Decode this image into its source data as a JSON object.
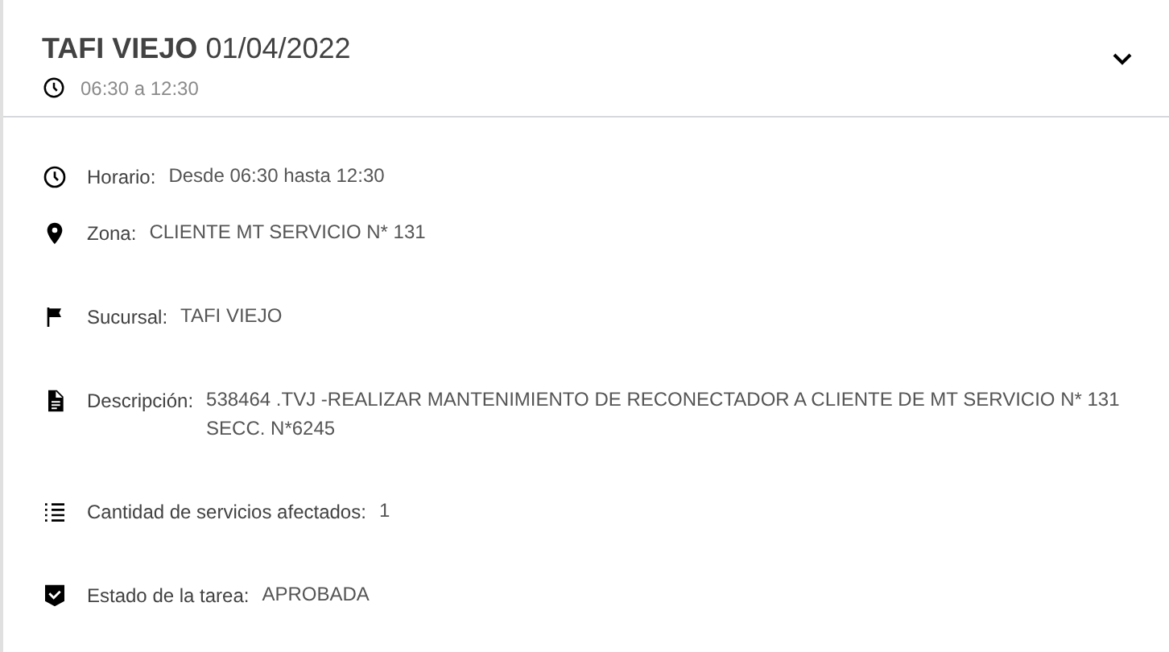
{
  "header": {
    "title": "TAFI VIEJO",
    "date": "01/04/2022",
    "time_range": "06:30 a 12:30",
    "expanded": true
  },
  "fields": [
    {
      "kind": "clock",
      "label": "Horario:",
      "value": "Desde 06:30 hasta 12:30"
    },
    {
      "kind": "pin",
      "label": "Zona:",
      "value": "CLIENTE MT SERVICIO N* 131"
    },
    {
      "kind": "flag",
      "label": "Sucursal:",
      "value": "TAFI VIEJO"
    },
    {
      "kind": "document",
      "label": "Descripción:",
      "value": "538464 .TVJ -REALIZAR MANTENIMIENTO DE RECONECTADOR A CLIENTE DE MT SERVICIO N* 131 SECC. N*6245"
    },
    {
      "kind": "list",
      "label": "Cantidad de servicios afectados:",
      "value": "1"
    },
    {
      "kind": "shield",
      "label": "Estado de la tarea:",
      "value": "APROBADA"
    }
  ]
}
